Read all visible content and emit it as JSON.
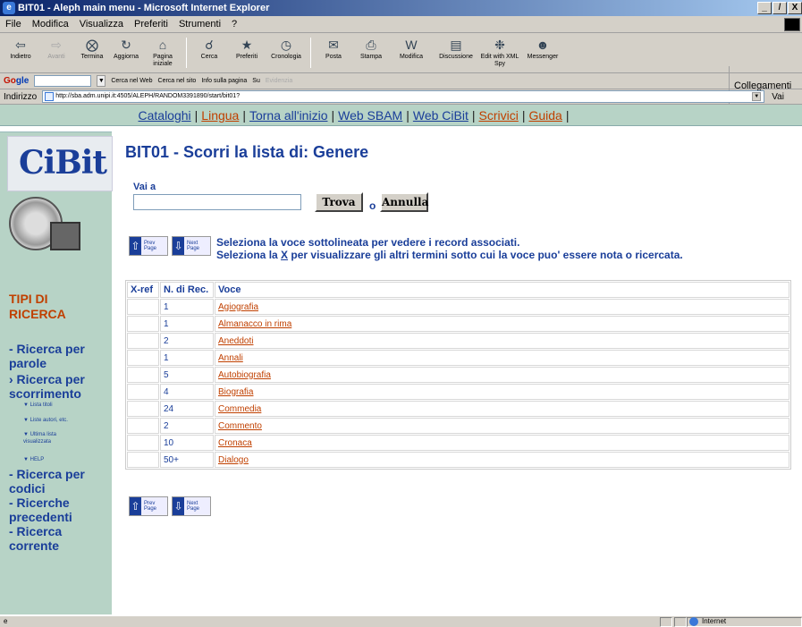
{
  "window": {
    "title": "BIT01 - Aleph main menu - Microsoft Internet Explorer",
    "btns": [
      "_",
      "̸",
      "X"
    ]
  },
  "menu": [
    "File",
    "Modifica",
    "Visualizza",
    "Preferiti",
    "Strumenti",
    "?"
  ],
  "toolbar": {
    "back": "Indietro",
    "forward": "Avanti",
    "stop": "Termina",
    "refresh": "Aggiorna",
    "home": "Pagina iniziale",
    "search": "Cerca",
    "favorites": "Preferiti",
    "history": "Cronologia",
    "mail": "Posta",
    "print": "Stampa",
    "edit": "Modifica",
    "discuss": "Discussione",
    "xmlspy": "Edit with XML Spy",
    "messenger": "Messenger",
    "links": "Collegamenti"
  },
  "google": {
    "logo_g": "Go",
    "logo_rest": "gle",
    "search_web": "Cerca nel Web",
    "search_site": "Cerca nel sito",
    "info": "Info sulla pagina",
    "up": "Su",
    "highlight": "Evidenzia"
  },
  "address": {
    "label": "Indirizzo",
    "url": "http://sba.adm.unipi.it:4505/ALEPH/RANDOM3391890/start/bit01?",
    "go": "Vai"
  },
  "topnav": [
    {
      "label": "Cataloghi",
      "color": "blue"
    },
    {
      "label": "Lingua",
      "color": "orange"
    },
    {
      "label": "Torna all'inizio",
      "color": "blue"
    },
    {
      "label": "Web SBAM",
      "color": "blue"
    },
    {
      "label": "Web CiBit",
      "color": "blue"
    },
    {
      "label": "Scrivici",
      "color": "orange"
    },
    {
      "label": "Guida",
      "color": "orange"
    }
  ],
  "sidebar": {
    "logo": "CiBit",
    "heading": "TIPI DI RICERCA",
    "items": [
      "- Ricerca per parole",
      "› Ricerca per scorrimento",
      "- Ricerca per codici",
      "- Ricerche precedenti",
      "- Ricerca corrente"
    ],
    "subitems": [
      "▼ Lista titoli",
      "▼ Liste autori, etc.",
      "▼ Ultima lista visualizzata",
      "▼ HELP"
    ]
  },
  "page": {
    "title": "BIT01 - Scorri la lista di: Genere",
    "vai_label": "Vai a",
    "trova": "Trova",
    "o": "o",
    "annulla": "Annulla",
    "prev": "Prev Page",
    "next": "Next Page",
    "instr1": "Seleziona la voce sottolineata per vedere i record associati.",
    "instr2_pre": "Seleziona la ",
    "instr2_x": "X",
    "instr2_post": " per visualizzare gli altri termini sotto cui la voce puo' essere nota o ricercata."
  },
  "table": {
    "headers": [
      "X-ref",
      "N. di Rec.",
      "Voce"
    ],
    "rows": [
      [
        "",
        "1",
        "Agiografia"
      ],
      [
        "",
        "1",
        "Almanacco in rima"
      ],
      [
        "",
        "2",
        "Aneddoti"
      ],
      [
        "",
        "1",
        "Annali"
      ],
      [
        "",
        "5",
        "Autobiografia"
      ],
      [
        "",
        "4",
        "Biografia"
      ],
      [
        "",
        "24",
        "Commedia"
      ],
      [
        "",
        "2",
        "Commento"
      ],
      [
        "",
        "10",
        "Cronaca"
      ],
      [
        "",
        "50+",
        "Dialogo"
      ]
    ]
  },
  "status": {
    "zone": "Internet"
  }
}
